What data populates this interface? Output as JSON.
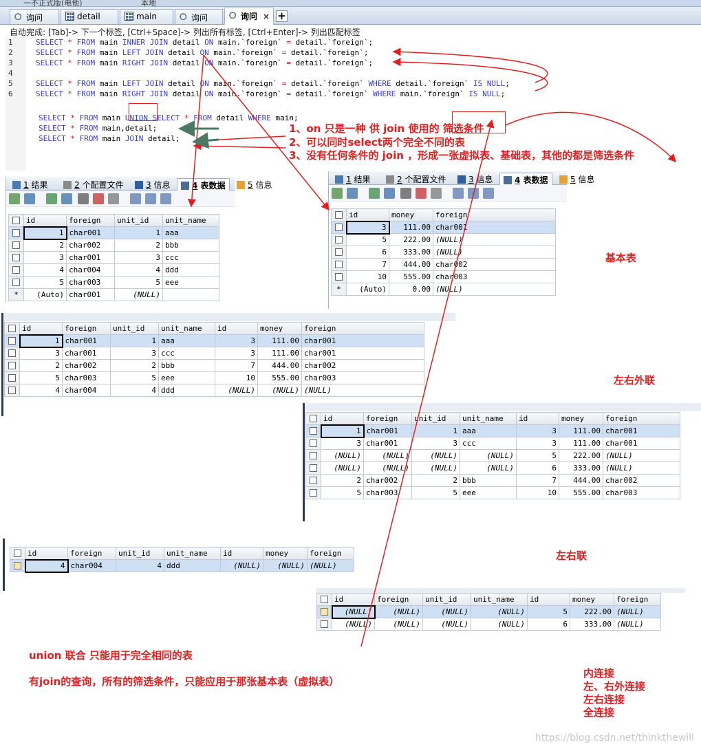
{
  "window": {
    "title_fragment": "一不正式版(电他)",
    "tab_fragment": "本地"
  },
  "tabs": [
    {
      "label": "询问",
      "icon": "query-icon",
      "active": false
    },
    {
      "label": "detail",
      "icon": "table-icon",
      "active": false
    },
    {
      "label": "main",
      "icon": "table-icon",
      "active": false
    },
    {
      "label": "询问",
      "icon": "query-icon",
      "active": false
    },
    {
      "label": "询问",
      "icon": "query-icon",
      "active": true
    }
  ],
  "editor": {
    "hint": "自动完成: [Tab]-> 下一个标签, [Ctrl+Space]-> 列出所有标签, [Ctrl+Enter]-> 列出匹配标签",
    "lines": [
      {
        "n": "1",
        "text": "SELECT * FROM main INNER JOIN detail ON main.`foreign` = detail.`foreign`;"
      },
      {
        "n": "2",
        "text": "SELECT * FROM main LEFT JOIN detail ON main.`foreign` = detail.`foreign`;"
      },
      {
        "n": "3",
        "text": "SELECT * FROM main RIGHT JOIN detail ON main.`foreign` = detail.`foreign`;"
      },
      {
        "n": "4",
        "text": ""
      },
      {
        "n": "5",
        "text": "SELECT * FROM main LEFT JOIN detail ON main.`foreign` = detail.`foreign` WHERE detail.`foreign` IS NULL;"
      },
      {
        "n": "6",
        "text": "SELECT * FROM main RIGHT JOIN detail ON main.`foreign` = detail.`foreign` WHERE main.`foreign` IS NULL;"
      }
    ],
    "extra_lines": [
      "SELECT * FROM main UNION SELECT * FROM detail WHERE main;",
      "SELECT * FROM main,detail;",
      "SELECT * FROM main JOIN detail;"
    ]
  },
  "panel_tabs": [
    {
      "num": "1",
      "label": "结果"
    },
    {
      "num": "2",
      "label": "个配置文件"
    },
    {
      "num": "3",
      "label": "信息"
    },
    {
      "num": "4",
      "label": "表数据"
    },
    {
      "num": "5",
      "label": "信息"
    }
  ],
  "main_table": {
    "headers": [
      "id",
      "foreign",
      "unit_id",
      "unit_name"
    ],
    "rows": [
      [
        "1",
        "char001",
        "1",
        "aaa"
      ],
      [
        "2",
        "char002",
        "2",
        "bbb"
      ],
      [
        "3",
        "char001",
        "3",
        "ccc"
      ],
      [
        "4",
        "char004",
        "4",
        "ddd"
      ],
      [
        "5",
        "char003",
        "5",
        "eee"
      ],
      [
        "(Auto)",
        "char001",
        "(NULL)",
        ""
      ]
    ]
  },
  "detail_table": {
    "headers": [
      "id",
      "money",
      "foreign"
    ],
    "rows": [
      [
        "3",
        "111.00",
        "char001"
      ],
      [
        "5",
        "222.00",
        "(NULL)"
      ],
      [
        "6",
        "333.00",
        "(NULL)"
      ],
      [
        "7",
        "444.00",
        "char002"
      ],
      [
        "10",
        "555.00",
        "char003"
      ],
      [
        "(Auto)",
        "0.00",
        "(NULL)"
      ]
    ]
  },
  "left_join_table": {
    "headers": [
      "id",
      "foreign",
      "unit_id",
      "unit_name",
      "id",
      "money",
      "foreign"
    ],
    "rows": [
      [
        "1",
        "char001",
        "1",
        "aaa",
        "3",
        "111.00",
        "char001"
      ],
      [
        "3",
        "char001",
        "3",
        "ccc",
        "3",
        "111.00",
        "char001"
      ],
      [
        "2",
        "char002",
        "2",
        "bbb",
        "7",
        "444.00",
        "char002"
      ],
      [
        "5",
        "char003",
        "5",
        "eee",
        "10",
        "555.00",
        "char003"
      ],
      [
        "4",
        "char004",
        "4",
        "ddd",
        "(NULL)",
        "(NULL)",
        "(NULL)"
      ]
    ]
  },
  "right_join_table": {
    "headers": [
      "id",
      "foreign",
      "unit_id",
      "unit_name",
      "id",
      "money",
      "foreign"
    ],
    "rows": [
      [
        "1",
        "char001",
        "1",
        "aaa",
        "3",
        "111.00",
        "char001"
      ],
      [
        "3",
        "char001",
        "3",
        "ccc",
        "3",
        "111.00",
        "char001"
      ],
      [
        "(NULL)",
        "(NULL)",
        "(NULL)",
        "(NULL)",
        "5",
        "222.00",
        "(NULL)"
      ],
      [
        "(NULL)",
        "(NULL)",
        "(NULL)",
        "(NULL)",
        "6",
        "333.00",
        "(NULL)"
      ],
      [
        "2",
        "char002",
        "2",
        "bbb",
        "7",
        "444.00",
        "char002"
      ],
      [
        "5",
        "char003",
        "5",
        "eee",
        "10",
        "555.00",
        "char003"
      ]
    ]
  },
  "left_only_table": {
    "headers": [
      "id",
      "foreign",
      "unit_id",
      "unit_name",
      "id",
      "money",
      "foreign"
    ],
    "rows": [
      [
        "4",
        "char004",
        "4",
        "ddd",
        "(NULL)",
        "(NULL)",
        "(NULL)"
      ]
    ]
  },
  "right_only_table": {
    "headers": [
      "id",
      "foreign",
      "unit_id",
      "unit_name",
      "id",
      "money",
      "foreign"
    ],
    "rows": [
      [
        "(NULL)",
        "(NULL)",
        "(NULL)",
        "(NULL)",
        "5",
        "222.00",
        "(NULL)"
      ],
      [
        "(NULL)",
        "(NULL)",
        "(NULL)",
        "(NULL)",
        "6",
        "333.00",
        "(NULL)"
      ]
    ]
  },
  "annotations": {
    "note1": "1、on 只是一种 供 join 使用的 筛选条件",
    "note2": "2、可以同时select两个完全不同的表",
    "note3": "3、没有任何条件的 join ，形成一张虚拟表、基础表，其他的都是筛选条件",
    "base_table": "基本表",
    "outer_join": "左右外联",
    "lr_join": "左右联",
    "union_note": "union 联合 只能用于完全相同的表",
    "join_note": "有join的查询，所有的筛选条件，只能应用于那张基本表（虚拟表）",
    "legend": [
      "内连接",
      "左、右外连接",
      "左右连接",
      "全连接"
    ]
  },
  "watermark": "https://blog.csdn.net/thinkthewill",
  "colors": {
    "annotation_red": "#e02020",
    "keyword_blue": "#3a3ad4",
    "selection": "#cfe0f5"
  }
}
